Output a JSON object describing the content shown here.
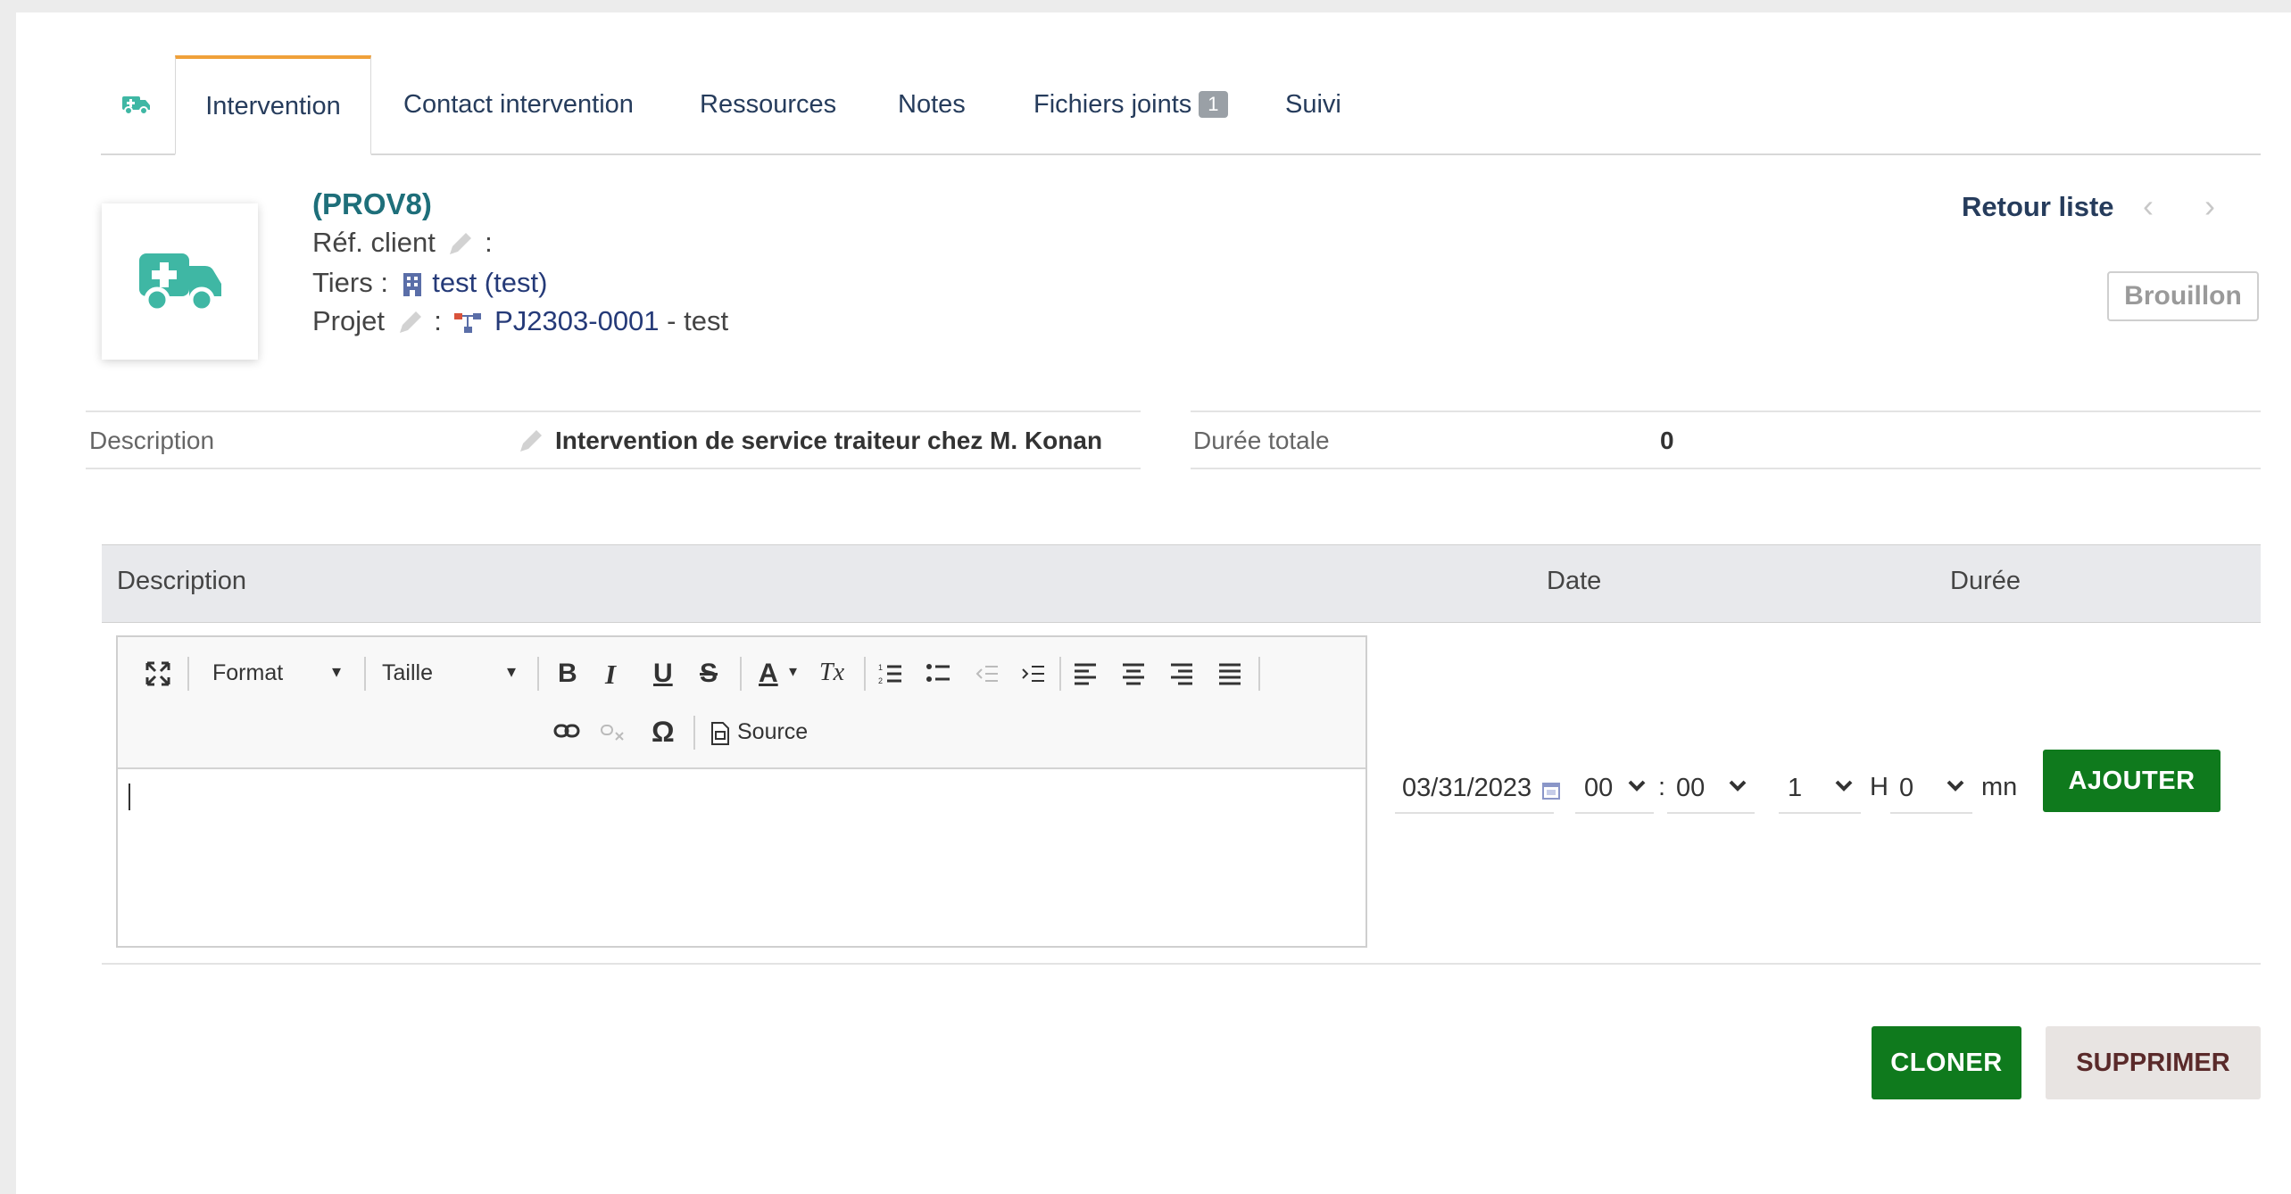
{
  "tabs": {
    "items": [
      {
        "label": "Intervention"
      },
      {
        "label": "Contact intervention"
      },
      {
        "label": "Ressources"
      },
      {
        "label": "Notes"
      },
      {
        "label": "Fichiers joints",
        "badge": "1"
      },
      {
        "label": "Suivi"
      }
    ]
  },
  "header": {
    "ref": "(PROV8)",
    "ref_client_label": "Réf. client",
    "ref_client_sep": ":",
    "tiers_label": "Tiers :",
    "tiers_value": "test (test)",
    "projet_label": "Projet",
    "projet_sep": ":",
    "projet_value": "PJ2303-0001",
    "projet_suffix": " - test",
    "retour": "Retour liste",
    "prev_arrow": "‹",
    "next_arrow": "›",
    "status": "Brouillon"
  },
  "fields": {
    "description_label": "Description",
    "description_value": "Intervention de service traiteur chez M. Konan",
    "duree_label": "Durée totale",
    "duree_value": "0"
  },
  "lines": {
    "col_description": "Description",
    "col_date": "Date",
    "col_duree": "Durée",
    "toolbar": {
      "format": "Format",
      "taille": "Taille",
      "bold": "B",
      "italic": "I",
      "underline": "U",
      "strike": "S",
      "color": "A",
      "clear": "Tx",
      "omega": "Ω",
      "source": "Source"
    },
    "date_value": "03/31/2023",
    "hour": "00",
    "time_sep": ":",
    "minute": "00",
    "dur_hours": "1",
    "h_label": "H",
    "dur_minutes": "0",
    "mn_label": "mn",
    "add_button": "AJOUTER"
  },
  "actions": {
    "clone": "CLONER",
    "delete": "SUPPRIMER"
  },
  "colors": {
    "accent_green": "#0f7a1d",
    "icon_teal": "#3fb7a4",
    "tab_active_border": "#f0a13a"
  }
}
